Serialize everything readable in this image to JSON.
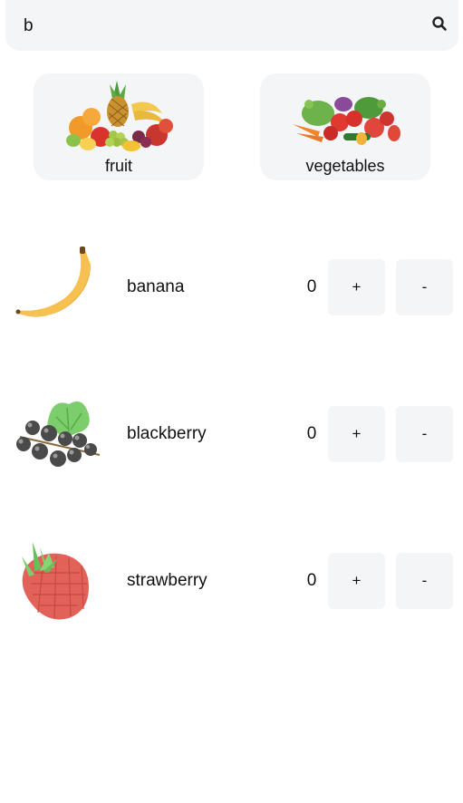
{
  "search": {
    "value": "b",
    "icon": "search-icon"
  },
  "categories": [
    {
      "label": "fruit",
      "icon": "fruit-basket-image"
    },
    {
      "label": "vegetables",
      "icon": "vegetables-basket-image"
    }
  ],
  "products": [
    {
      "name": "banana",
      "count": "0",
      "plus_label": "+",
      "minus_label": "-",
      "icon": "banana-image"
    },
    {
      "name": "blackberry",
      "count": "0",
      "plus_label": "+",
      "minus_label": "-",
      "icon": "blackberry-image"
    },
    {
      "name": "strawberry",
      "count": "0",
      "plus_label": "+",
      "minus_label": "-",
      "icon": "strawberry-image"
    }
  ],
  "colors": {
    "surface": "#f4f5f7",
    "text": "#111111",
    "banana": "#f7c152",
    "berry": "#4a4a4a",
    "strawberry": "#e2625a",
    "leaf": "#7ccd6c"
  }
}
